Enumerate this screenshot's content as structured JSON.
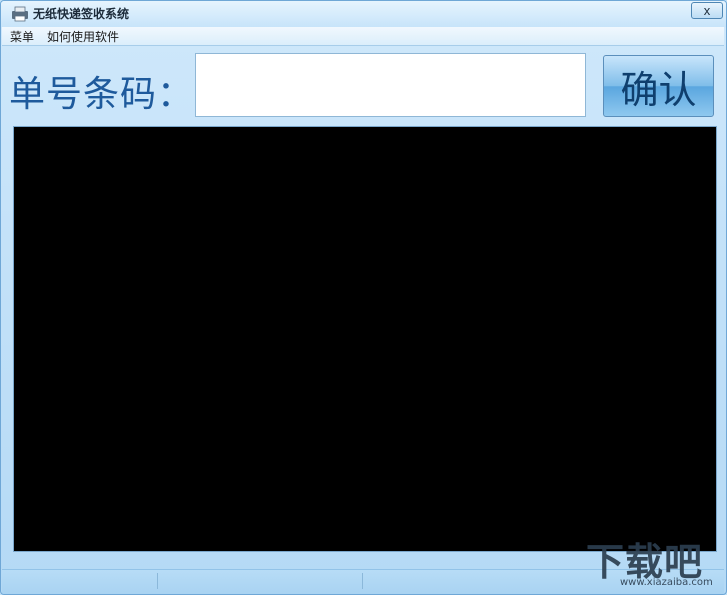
{
  "window": {
    "title": "无纸快递签收系统",
    "app_icon": "printer-icon",
    "close_symbol": "x"
  },
  "menubar": {
    "items": [
      {
        "label": "菜单"
      },
      {
        "label": "如何使用软件"
      }
    ]
  },
  "form": {
    "barcode_label": "单号条码：",
    "barcode_value": "",
    "confirm_label": "确认"
  },
  "watermark": {
    "text": "下载吧",
    "url": "www.xiazaiba.com"
  },
  "colors": {
    "accent": "#1e5a9c",
    "window_bg": "#bfe0f7",
    "output_bg": "#000000"
  }
}
